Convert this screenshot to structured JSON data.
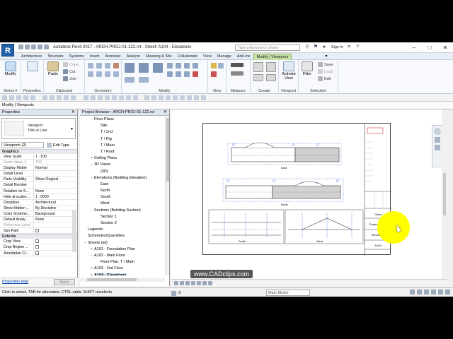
{
  "window": {
    "logo": "R",
    "title": "Autodesk Revit 2017 -     ARCH-PROJ-01-122.rvt - Sheet: A104 - Elevations",
    "search_placeholder": "Type a keyword or phrase",
    "sign_in": "Sign In",
    "controls": [
      "–",
      "□",
      "✕"
    ]
  },
  "tabs": [
    {
      "label": "Architecture",
      "state": "normal"
    },
    {
      "label": "Structure",
      "state": "normal"
    },
    {
      "label": "Systems",
      "state": "normal"
    },
    {
      "label": "Insert",
      "state": "normal"
    },
    {
      "label": "Annotate",
      "state": "normal"
    },
    {
      "label": "Analyze",
      "state": "normal"
    },
    {
      "label": "Massing & Site",
      "state": "normal"
    },
    {
      "label": "Collaborate",
      "state": "normal"
    },
    {
      "label": "View",
      "state": "normal"
    },
    {
      "label": "Manage",
      "state": "normal"
    },
    {
      "label": "Add-Ins",
      "state": "normal"
    },
    {
      "label": "Modify | Viewports",
      "state": "contextual"
    }
  ],
  "ribbon": {
    "select": {
      "button": "Modify",
      "panel": "Select ▾"
    },
    "properties": {
      "panel": "Properties"
    },
    "clipboard": {
      "paste": "Paste",
      "copy": "Cope",
      "cut": "Cut",
      "join": "Join",
      "panel": "Clipboard"
    },
    "geometry": {
      "panel": "Geometry"
    },
    "modify": {
      "panel": "Modify"
    },
    "view": {
      "panel": "View"
    },
    "measure": {
      "panel": "Measure"
    },
    "create": {
      "panel": "Create"
    },
    "viewport": {
      "activate": "Activate\nView",
      "panel": "Viewport"
    },
    "selection": {
      "filter": "Filter",
      "save": "Save",
      "load": "Load",
      "edit": "Edit",
      "panel": "Selection"
    }
  },
  "context_label": "Modify | Viewports",
  "properties": {
    "header": "Properties",
    "type_family": "Viewport",
    "type_name": "Title w Line",
    "instance_selector": "Viewports (2)",
    "edit_type": "Edit Type",
    "groups": [
      {
        "name": "Graphics",
        "rows": [
          {
            "name": "View Scale",
            "value": "1 : 100",
            "gray": false
          },
          {
            "name": "Scale Value   1:",
            "value": "100",
            "gray": true
          },
          {
            "name": "Display Model",
            "value": "Normal",
            "gray": false
          },
          {
            "name": "Detail Level",
            "value": "",
            "gray": false
          },
          {
            "name": "Parts Visibility",
            "value": "Show Original",
            "gray": false
          },
          {
            "name": "Detail Number",
            "value": "",
            "gray": false
          },
          {
            "name": "Rotation on S...",
            "value": "None",
            "gray": false
          },
          {
            "name": "Hide at scales ...",
            "value": "1 : 5000",
            "gray": false
          },
          {
            "name": "Discipline",
            "value": "Architectural",
            "gray": false
          },
          {
            "name": "Show Hidden ...",
            "value": "By Discipline",
            "gray": false
          },
          {
            "name": "Color Scheme...",
            "value": "Background",
            "gray": false
          },
          {
            "name": "Default Analy...",
            "value": "None",
            "gray": false
          },
          {
            "name": "Reference Label",
            "value": "",
            "gray": true
          },
          {
            "name": "Sun Path",
            "value": "checkbox",
            "gray": false
          }
        ]
      },
      {
        "name": "Extents",
        "rows": [
          {
            "name": "Crop View",
            "value": "checkbox",
            "gray": false
          },
          {
            "name": "Crop Region ...",
            "value": "checkbox",
            "gray": false
          },
          {
            "name": "Annotation Cr...",
            "value": "checkbox",
            "gray": false
          }
        ]
      }
    ],
    "help_link": "Properties help",
    "apply": "Apply"
  },
  "browser": {
    "header": "Project Browser - ARCH-PROJ-01-122.rvt",
    "nodes": [
      {
        "label": "Floor Plans",
        "depth": 1,
        "toggle": "−",
        "selected": false
      },
      {
        "label": "Site",
        "depth": 2,
        "toggle": "",
        "selected": false
      },
      {
        "label": "T / 2nd",
        "depth": 2,
        "toggle": "",
        "selected": false
      },
      {
        "label": "T / Ftg",
        "depth": 2,
        "toggle": "",
        "selected": false
      },
      {
        "label": "T / Main",
        "depth": 2,
        "toggle": "",
        "selected": false
      },
      {
        "label": "T / Roof",
        "depth": 2,
        "toggle": "",
        "selected": false
      },
      {
        "label": "Ceiling Plans",
        "depth": 1,
        "toggle": "+",
        "selected": false
      },
      {
        "label": "3D Views",
        "depth": 1,
        "toggle": "−",
        "selected": false
      },
      {
        "label": "{3D}",
        "depth": 2,
        "toggle": "",
        "selected": false
      },
      {
        "label": "Elevations (Building Elevation)",
        "depth": 1,
        "toggle": "−",
        "selected": false
      },
      {
        "label": "East",
        "depth": 2,
        "toggle": "",
        "selected": false
      },
      {
        "label": "North",
        "depth": 2,
        "toggle": "",
        "selected": false
      },
      {
        "label": "South",
        "depth": 2,
        "toggle": "",
        "selected": false
      },
      {
        "label": "West",
        "depth": 2,
        "toggle": "",
        "selected": false
      },
      {
        "label": "Sections (Building Section)",
        "depth": 1,
        "toggle": "−",
        "selected": false
      },
      {
        "label": "Section 1",
        "depth": 2,
        "toggle": "",
        "selected": false
      },
      {
        "label": "Section 2",
        "depth": 2,
        "toggle": "",
        "selected": false
      },
      {
        "label": "Legends",
        "depth": 0,
        "toggle": "",
        "selected": false
      },
      {
        "label": "Schedules/Quantities",
        "depth": 0,
        "toggle": "",
        "selected": false
      },
      {
        "label": "Sheets (all)",
        "depth": 0,
        "toggle": "−",
        "selected": false
      },
      {
        "label": "A101 - Foundation Plan",
        "depth": 1,
        "toggle": "+",
        "selected": false
      },
      {
        "label": "A102 - Main Floor",
        "depth": 1,
        "toggle": "−",
        "selected": false
      },
      {
        "label": "Floor Plan: T / Main",
        "depth": 2,
        "toggle": "",
        "selected": false
      },
      {
        "label": "A103 - 2nd Floor",
        "depth": 1,
        "toggle": "+",
        "selected": false
      },
      {
        "label": "A104 - Elevations",
        "depth": 1,
        "toggle": "+",
        "selected": true
      },
      {
        "label": "Families",
        "depth": 0,
        "toggle": "+",
        "selected": false
      }
    ]
  },
  "sheet": {
    "titleblock_rows": [
      "Client",
      "Project Name",
      "Elevations",
      "A104"
    ],
    "view_titles": [
      "East",
      "North",
      "South",
      "West"
    ]
  },
  "watermark": "www.CADclips.com",
  "status": {
    "hint": "Click to select, TAB for alternates, CTRL adds, SHIFT unselects.",
    "zero": ":0",
    "model": "Main Model"
  },
  "colors": {
    "accent": "#1f5fa8",
    "contextual_tab": "#c6e1a8",
    "highlight": "#ffff00"
  }
}
